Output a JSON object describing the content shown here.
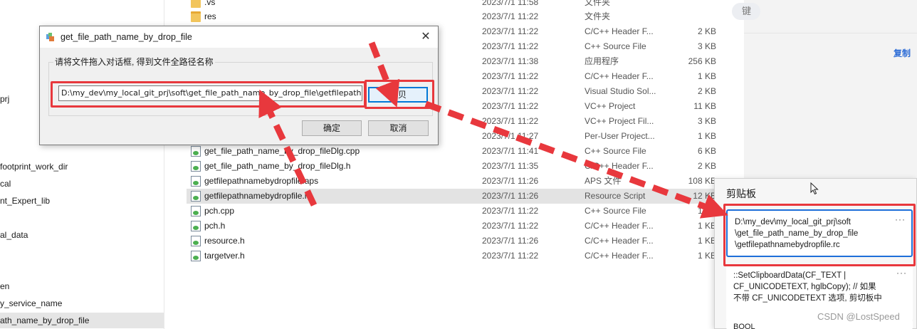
{
  "nav": {
    "items": [
      {
        "label": "prj",
        "selected": false
      },
      {
        "label": "footprint_work_dir",
        "selected": false
      },
      {
        "label": "cal",
        "selected": false
      },
      {
        "label": "nt_Expert_lib",
        "selected": false
      },
      {
        "label": "al_data",
        "selected": false
      },
      {
        "label": "en",
        "selected": false
      },
      {
        "label": "y_service_name",
        "selected": false
      },
      {
        "label": "ath_name_by_drop_file",
        "selected": true
      }
    ]
  },
  "files": [
    {
      "name": ".vs",
      "date": "2023/7/1 11:58",
      "type": "文件夹",
      "size": "",
      "icon": "folder-icon",
      "selected": false
    },
    {
      "name": "res",
      "date": "2023/7/1 11:22",
      "type": "文件夹",
      "size": "",
      "icon": "folder-icon",
      "selected": false
    },
    {
      "name": "",
      "date": "2023/7/1 11:22",
      "type": "C/C++ Header F...",
      "size": "2 KB",
      "icon": "file-icon",
      "selected": false
    },
    {
      "name": "",
      "date": "2023/7/1 11:22",
      "type": "C++ Source File",
      "size": "3 KB",
      "icon": "file-icon",
      "selected": false
    },
    {
      "name": "",
      "date": "2023/7/1 11:38",
      "type": "应用程序",
      "size": "256 KB",
      "icon": "file-icon",
      "selected": false
    },
    {
      "name": "",
      "date": "2023/7/1 11:22",
      "type": "C/C++ Header F...",
      "size": "1 KB",
      "icon": "file-icon",
      "selected": false
    },
    {
      "name": "",
      "date": "2023/7/1 11:22",
      "type": "Visual Studio Sol...",
      "size": "2 KB",
      "icon": "file-icon",
      "selected": false
    },
    {
      "name": "",
      "date": "2023/7/1 11:22",
      "type": "VC++ Project",
      "size": "11 KB",
      "icon": "file-icon",
      "selected": false
    },
    {
      "name": "",
      "date": "2023/7/1 11:22",
      "type": "VC++ Project Fil...",
      "size": "3 KB",
      "icon": "file-icon",
      "selected": false
    },
    {
      "name": "",
      "date": "2023/7/1 11:27",
      "type": "Per-User Project...",
      "size": "1 KB",
      "icon": "file-icon",
      "selected": false
    },
    {
      "name": "get_file_path_name_by_drop_fileDlg.cpp",
      "date": "2023/7/1 11:41",
      "type": "C++ Source File",
      "size": "6 KB",
      "icon": "file-icon",
      "selected": false
    },
    {
      "name": "get_file_path_name_by_drop_fileDlg.h",
      "date": "2023/7/1 11:35",
      "type": "C/C++ Header F...",
      "size": "2 KB",
      "icon": "file-icon",
      "selected": false
    },
    {
      "name": "getfilepathnamebydropfile.aps",
      "date": "2023/7/1 11:26",
      "type": "APS 文件",
      "size": "108 KB",
      "icon": "file-icon",
      "selected": false
    },
    {
      "name": "getfilepathnamebydropfile.rc",
      "date": "2023/7/1 11:26",
      "type": "Resource Script",
      "size": "12 KB",
      "icon": "file-icon",
      "selected": true
    },
    {
      "name": "pch.cpp",
      "date": "2023/7/1 11:22",
      "type": "C++ Source File",
      "size": "1 KB",
      "icon": "file-icon",
      "selected": false
    },
    {
      "name": "pch.h",
      "date": "2023/7/1 11:22",
      "type": "C/C++ Header F...",
      "size": "1 KB",
      "icon": "file-icon",
      "selected": false
    },
    {
      "name": "resource.h",
      "date": "2023/7/1 11:26",
      "type": "C/C++ Header F...",
      "size": "1 KB",
      "icon": "file-icon",
      "selected": false
    },
    {
      "name": "targetver.h",
      "date": "2023/7/1 11:22",
      "type": "C/C++ Header F...",
      "size": "1 KB",
      "icon": "file-icon",
      "selected": false
    }
  ],
  "right": {
    "key_label": "键",
    "copy_link": "复制"
  },
  "clipboard": {
    "title": "剪贴板",
    "more": "···",
    "items": [
      {
        "lines": [
          "D:\\my_dev\\my_local_git_prj\\soft",
          "\\get_file_path_name_by_drop_file",
          "\\getfilepathnamebydropfile.rc"
        ]
      },
      {
        "lines": [
          "::SetClipboardData(CF_TEXT |",
          "CF_UNICODETEXT, hglbCopy); // 如果",
          "不带 CF_UNICODETEXT 选项, 剪切板中"
        ]
      },
      {
        "lines": [
          "BOOL"
        ]
      }
    ]
  },
  "dialog": {
    "title": "get_file_path_name_by_drop_file",
    "close": "✕",
    "group_label": "请将文件拖入对话框, 得到文件全路径名称",
    "path_value": "D:\\my_dev\\my_local_git_prj\\soft\\get_file_path_name_by_drop_file\\getfilepathnamebydropfile.rc",
    "copy_button": "拷贝",
    "ok_button": "确定",
    "cancel_button": "取消"
  },
  "watermark": "CSDN @LostSpeed",
  "colors": {
    "annotation_red": "#e8383d",
    "accent_blue": "#1e6fd9",
    "selected_row": "#e3e3e3"
  }
}
